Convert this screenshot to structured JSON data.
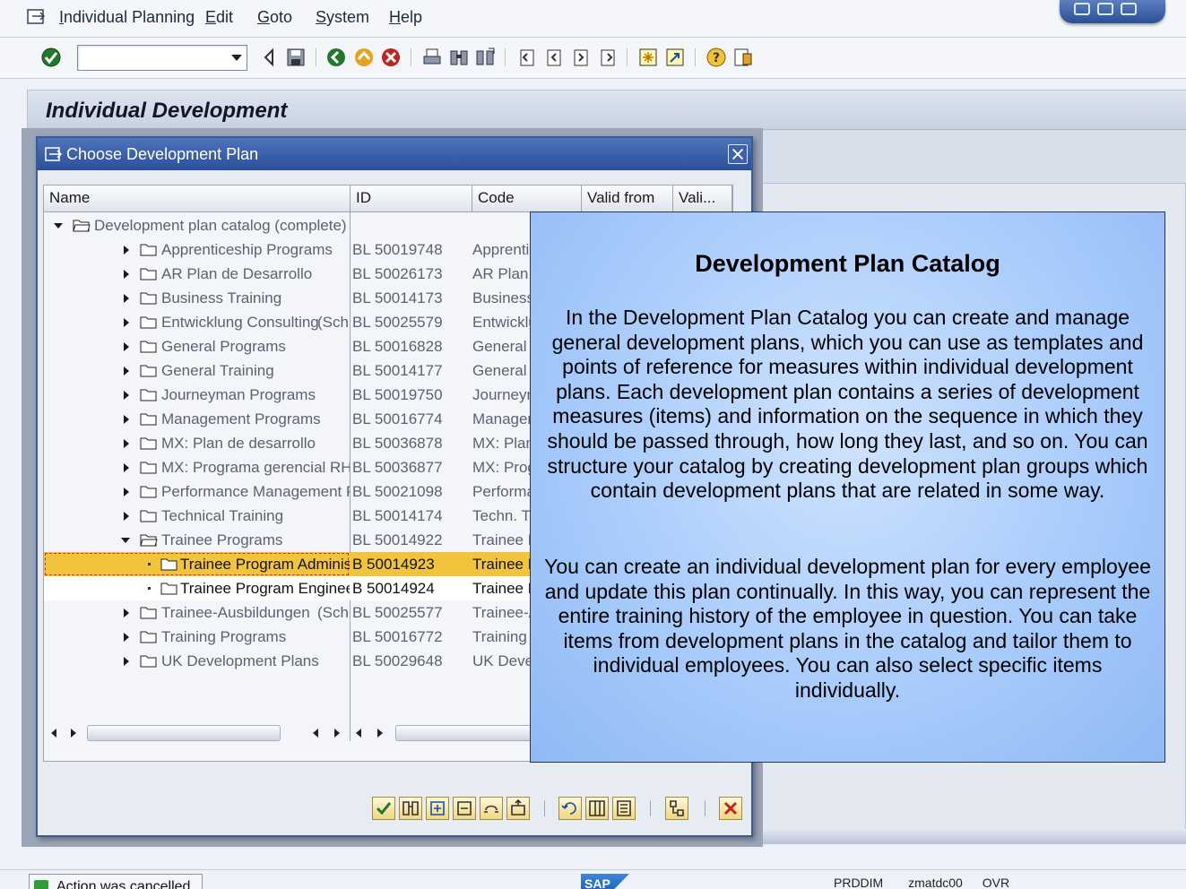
{
  "menu": {
    "items": [
      {
        "label": "Individual Planning",
        "accel": "I",
        "rest": "ndividual Planning"
      },
      {
        "label": "Edit",
        "accel": "E",
        "rest": "dit"
      },
      {
        "label": "Goto",
        "accel": "G",
        "rest": "oto"
      },
      {
        "label": "System",
        "accel": "S",
        "rest": "ystem"
      },
      {
        "label": "Help",
        "accel": "H",
        "rest": "elp"
      }
    ]
  },
  "toolbar": {
    "command_field_value": "",
    "icons": [
      "enter-icon",
      "back-icon",
      "save-icon",
      "back-green-icon",
      "exit-icon",
      "cancel-icon",
      "print-icon",
      "find-icon",
      "find-next-icon",
      "first-page-icon",
      "prev-page-icon",
      "next-page-icon",
      "last-page-icon",
      "new-session-icon",
      "shortcut-icon",
      "help-icon",
      "layout-icon"
    ]
  },
  "screen": {
    "title": "Individual Development"
  },
  "dialog": {
    "title": "Choose Development Plan",
    "columns": [
      "Name",
      "ID",
      "Code",
      "Valid from",
      "Vali..."
    ],
    "root": "Development plan catalog (complete)",
    "rows": [
      {
        "name": "Apprenticeship Programs",
        "extra": "",
        "id": "BL 50019748",
        "code": "Apprenti"
      },
      {
        "name": "AR Plan de Desarrollo",
        "extra": "",
        "id": "BL 50026173",
        "code": "AR Plan d"
      },
      {
        "name": "Business Training",
        "extra": "",
        "id": "BL 50014173",
        "code": "Business"
      },
      {
        "name": "Entwicklung Consulting",
        "extra": "(Sch",
        "id": "BL 50025579",
        "code": "Entwicklu"
      },
      {
        "name": "General Programs",
        "extra": "",
        "id": "BL 50016828",
        "code": "General P"
      },
      {
        "name": "General Training",
        "extra": "",
        "id": "BL 50014177",
        "code": "General T"
      },
      {
        "name": "Journeyman Programs",
        "extra": "",
        "id": "BL 50019750",
        "code": "Journeym"
      },
      {
        "name": "Management Programs",
        "extra": "",
        "id": "BL 50016774",
        "code": "Managem"
      },
      {
        "name": "MX: Plan de desarrollo",
        "extra": "",
        "id": "BL 50036878",
        "code": "MX: Plan"
      },
      {
        "name": "MX: Programa gerencial RH",
        "extra": "",
        "id": "BL 50036877",
        "code": "MX: Prog"
      },
      {
        "name": "Performance Management Plan Gr",
        "extra": "",
        "id": "BL 50021098",
        "code": "Performa"
      },
      {
        "name": "Technical Training",
        "extra": "",
        "id": "BL 50014174",
        "code": "Techn. T"
      },
      {
        "name": "Trainee Programs",
        "extra": "",
        "id": "BL 50014922",
        "code": "Trainee P"
      },
      {
        "name": "Trainee Program Administration",
        "extra": "",
        "id": "B  50014923",
        "code": "Trainee P"
      },
      {
        "name": "Trainee Program Engineering",
        "extra": "",
        "id": "B  50014924",
        "code": "Trainee P"
      },
      {
        "name": "Trainee-Ausbildungen",
        "extra": "(Sch",
        "id": "BL 50025577",
        "code": "Trainee-A"
      },
      {
        "name": "Training Programs",
        "extra": "",
        "id": "BL 50016772",
        "code": "Training"
      },
      {
        "name": "UK Development Plans",
        "extra": "",
        "id": "BL 50029648",
        "code": "UK Deve"
      }
    ],
    "footer_icons": [
      "confirm-icon",
      "find-icon",
      "expand-icon",
      "collapse-icon",
      "expand-all-icon",
      "collapse-all-icon",
      "refresh-icon",
      "column-select-icon",
      "details-icon",
      "tree-icon",
      "cancel-icon"
    ]
  },
  "callout": {
    "title": "Development Plan Catalog",
    "paragraph1": "In the Development Plan Catalog you can create and manage general development plans, which you can use as templates and points of reference for measures within individual development plans. Each development plan contains a series of development measures (items) and information on the sequence in which they should be passed through, how long they last, and so on. You can structure your catalog by creating development plan groups which contain development plans that are related in some way.",
    "paragraph2": "You can create an individual development plan for every employee and update this plan continually. In this way, you can represent the entire training history of the employee in question. You can take items from development plans in the catalog and tailor them to individual employees. You can also select specific items individually."
  },
  "status": {
    "message": "Action was cancelled",
    "logo": "SAP",
    "system": "PRDDIM",
    "server": "zmatdc00",
    "mode": "OVR"
  },
  "colors": {
    "dialog_header": "#2c4f98",
    "callout_bg": "#a9ccfb",
    "selection": "#f2c43c"
  }
}
